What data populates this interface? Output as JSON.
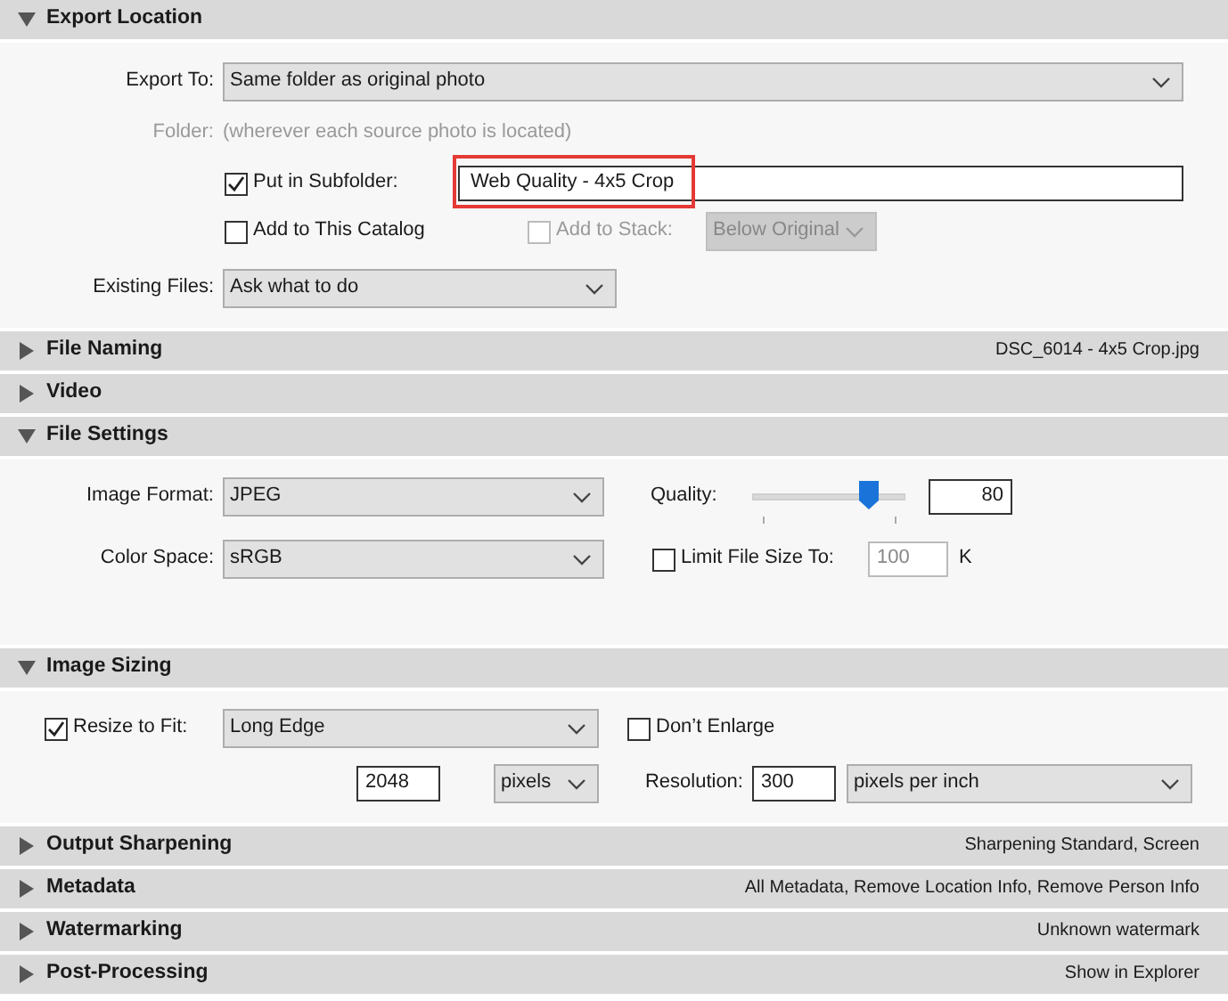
{
  "sections": [
    {
      "kind": "export_location",
      "title": "Export Location",
      "expanded": true,
      "export_to": {
        "label": "Export To:",
        "value": "Same folder as original photo"
      },
      "folder": {
        "label": "Folder:",
        "value": "(wherever each source photo is located)",
        "disabled": true
      },
      "put_in_subfolder": {
        "label": "Put in Subfolder:",
        "checked": true,
        "value": "Web Quality - 4x5 Crop",
        "highlighted": true
      },
      "add_to_catalog": {
        "label": "Add to This Catalog",
        "checked": false
      },
      "add_to_stack": {
        "label": "Add to Stack:",
        "checked": false,
        "disabled": true,
        "value": "Below Original"
      },
      "existing_files": {
        "label": "Existing Files:",
        "value": "Ask what to do"
      }
    },
    {
      "title": "File Naming",
      "expanded": false,
      "summary": "DSC_6014 - 4x5 Crop.jpg"
    },
    {
      "title": "Video",
      "expanded": false
    },
    {
      "kind": "file_settings",
      "title": "File Settings",
      "expanded": true,
      "image_format": {
        "label": "Image Format:",
        "value": "JPEG"
      },
      "quality": {
        "label": "Quality:",
        "level": 0.76,
        "value": "80"
      },
      "color_space": {
        "label": "Color Space:",
        "value": "sRGB"
      },
      "limit_file_size": {
        "label": "Limit File Size To:",
        "checked": false,
        "value": "100",
        "disabled": true,
        "unit": "K"
      }
    },
    {
      "kind": "image_sizing",
      "title": "Image Sizing",
      "expanded": true,
      "resize_to_fit": {
        "label": "Resize to Fit:",
        "checked": true,
        "value": "Long Edge"
      },
      "dont_enlarge": {
        "label": "Don’t Enlarge",
        "checked": false
      },
      "size": {
        "value": "2048",
        "unit": "pixels"
      },
      "resolution": {
        "label": "Resolution:",
        "value": "300",
        "unit": "pixels per inch"
      }
    },
    {
      "title": "Output Sharpening",
      "expanded": false,
      "summary": "Sharpening Standard, Screen"
    },
    {
      "title": "Metadata",
      "expanded": false,
      "summary": "All Metadata, Remove Location Info, Remove Person Info"
    },
    {
      "title": "Watermarking",
      "expanded": false,
      "summary": "Unknown watermark"
    },
    {
      "title": "Post-Processing",
      "expanded": false,
      "summary": "Show in Explorer"
    }
  ]
}
